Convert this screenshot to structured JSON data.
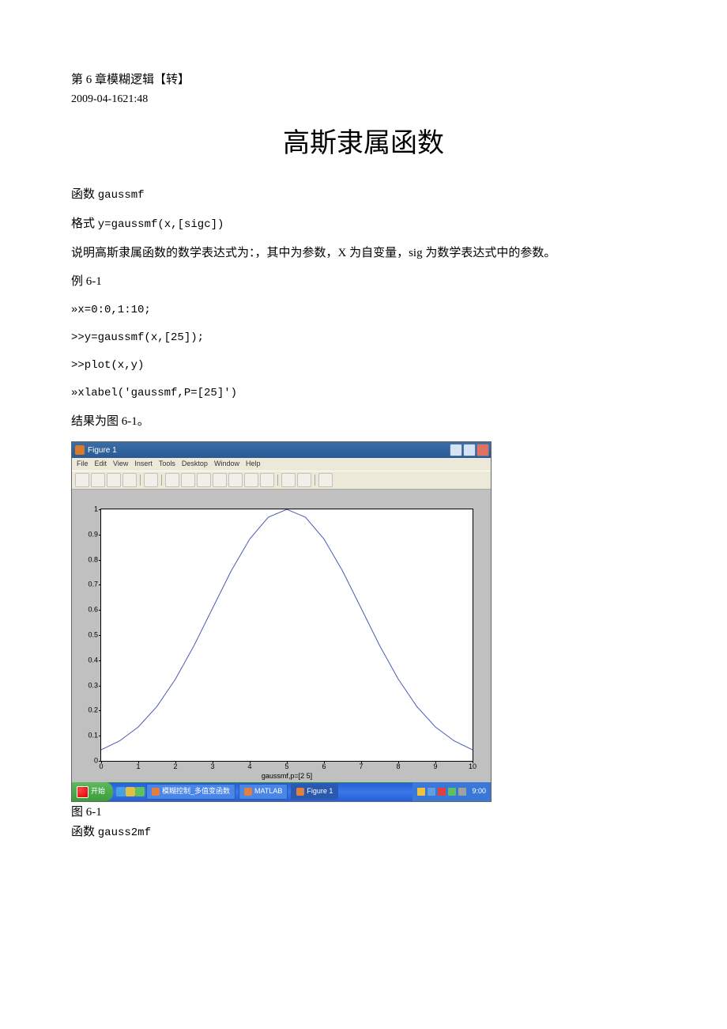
{
  "doc": {
    "chapter_title": "第 6 章模糊逻辑【转】",
    "date": "2009-04-1621:48",
    "main_title": "高斯隶属函数",
    "para_func_label": "函数",
    "para_func_name": "gaussmf",
    "para_format_label": "格式",
    "para_format_code": "y=gaussmf(x,[sigc])",
    "para_desc": "说明高斯隶属函数的数学表达式为：，其中为参数，X 为自变量，sig 为数学表达式中的参数。",
    "para_example": "例 6-1",
    "code1": "»x=0:0,1:10;",
    "code2": ">>y=gaussmf(x,[25]);",
    "code3": ">>plot(x,y)",
    "code4": "»xlabel('gaussmf,P=[25]')",
    "para_result": "结果为图 6-1。",
    "caption": "图 6-1",
    "para_func2_label": "函数",
    "para_func2_name": "gauss2mf"
  },
  "figure": {
    "window_title": "Figure 1",
    "menus": [
      "File",
      "Edit",
      "View",
      "Insert",
      "Tools",
      "Desktop",
      "Window",
      "Help"
    ],
    "xlabel": "gaussmf,p=[2 5]"
  },
  "chart_data": {
    "type": "line",
    "title": "",
    "xlabel": "gaussmf,p=[2 5]",
    "ylabel": "",
    "xlim": [
      0,
      10
    ],
    "ylim": [
      0,
      1
    ],
    "xticks": [
      0,
      1,
      2,
      3,
      4,
      5,
      6,
      7,
      8,
      9,
      10
    ],
    "yticks": [
      0,
      0.1,
      0.2,
      0.3,
      0.4,
      0.5,
      0.6,
      0.7,
      0.8,
      0.9,
      1
    ],
    "series": [
      {
        "name": "gaussmf",
        "x": [
          0,
          0.5,
          1,
          1.5,
          2,
          2.5,
          3,
          3.5,
          4,
          4.5,
          5,
          5.5,
          6,
          6.5,
          7,
          7.5,
          8,
          8.5,
          9,
          9.5,
          10
        ],
        "values": [
          0.044,
          0.08,
          0.135,
          0.216,
          0.325,
          0.458,
          0.607,
          0.755,
          0.882,
          0.969,
          1.0,
          0.969,
          0.882,
          0.755,
          0.607,
          0.458,
          0.325,
          0.216,
          0.135,
          0.08,
          0.044
        ]
      }
    ]
  },
  "taskbar": {
    "start": "开始",
    "items": [
      "模糊控制_多值变函数",
      "MATLAB",
      "Figure 1"
    ],
    "time": "9:00"
  }
}
